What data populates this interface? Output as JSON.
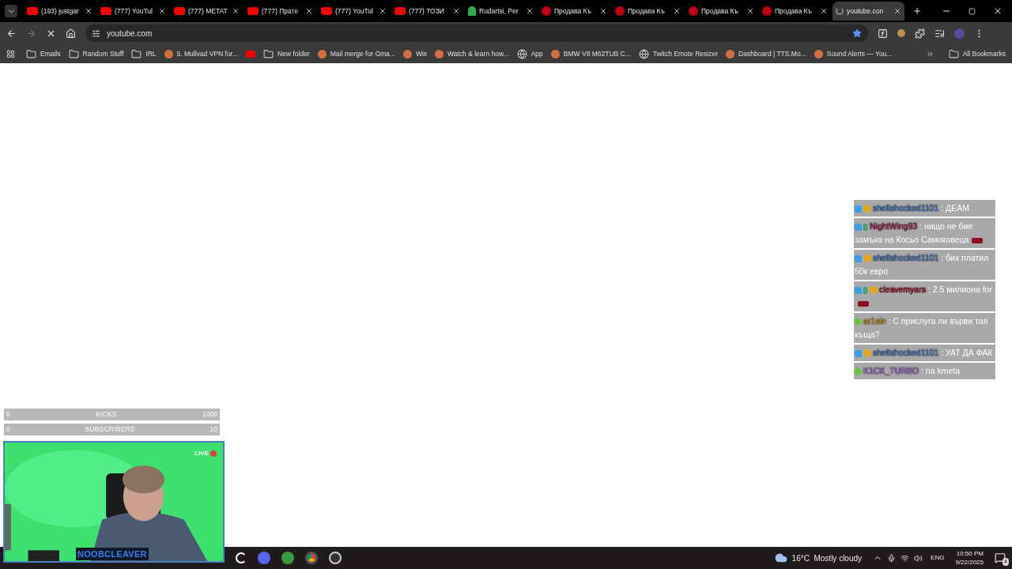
{
  "tabs": [
    {
      "title": "(193) justgar",
      "kind": "youtube",
      "selected": false
    },
    {
      "title": "(777) YouTul",
      "kind": "youtube",
      "selected": false
    },
    {
      "title": "(777) METAT",
      "kind": "youtube",
      "selected": false
    },
    {
      "title": "(777) Прате",
      "kind": "youtube",
      "selected": false
    },
    {
      "title": "(777) YouTul",
      "kind": "youtube",
      "selected": false
    },
    {
      "title": "(777) ТОЗИ",
      "kind": "youtube",
      "selected": false
    },
    {
      "title": "Rudartsi, Per",
      "kind": "maps",
      "selected": false
    },
    {
      "title": "Продава Къ",
      "kind": "red",
      "selected": false
    },
    {
      "title": "Продава Къ",
      "kind": "red",
      "selected": false
    },
    {
      "title": "Продава Къ",
      "kind": "red",
      "selected": false
    },
    {
      "title": "Продава Къ",
      "kind": "red",
      "selected": false
    },
    {
      "title": "youtube.con",
      "kind": "loading",
      "selected": true
    }
  ],
  "address": "youtube.com",
  "bookmarked": true,
  "bookmarks": [
    {
      "label": "Emails",
      "kind": "folder"
    },
    {
      "label": "Random Stuff",
      "kind": "folder"
    },
    {
      "label": "IRL",
      "kind": "folder"
    },
    {
      "label": "5. Mullvad VPN for...",
      "kind": "site"
    },
    {
      "kind": "youtube"
    },
    {
      "label": "New folder",
      "kind": "folder"
    },
    {
      "label": "Mail merge for Gma...",
      "kind": "site"
    },
    {
      "label": "Wix",
      "kind": "site"
    },
    {
      "label": "Watch & learn how...",
      "kind": "site"
    },
    {
      "label": "App",
      "kind": "globe"
    },
    {
      "label": "BMW V8 M62TUB C...",
      "kind": "site"
    },
    {
      "label": "Twitch Emote Resizer",
      "kind": "globe"
    },
    {
      "label": "Dashboard | TTS.Mo...",
      "kind": "site"
    },
    {
      "label": "Sound Alerts — You...",
      "kind": "site"
    }
  ],
  "all_bookmarks": "All Bookmarks",
  "chat": [
    {
      "user": "shellshocked1101",
      "color": "#4a7fd0",
      "message": ": ДЕАМ",
      "badges": [
        {
          "kind": "cube"
        },
        {
          "kind": "coin"
        }
      ],
      "emote": false
    },
    {
      "user": "NightWing93",
      "color": "#a8205a",
      "message": ": нищо не бие замъка на Косьо Самоковеца",
      "badges": [
        {
          "kind": "cube"
        },
        {
          "kind": "zero"
        }
      ],
      "emote": true
    },
    {
      "user": "shellshocked1101",
      "color": "#4a7fd0",
      "message": ": бих платил 50к евро",
      "badges": [
        {
          "kind": "cube"
        },
        {
          "kind": "coin"
        }
      ],
      "emote": false
    },
    {
      "user": "cleavemyars",
      "color": "#b0102a",
      "message": ": 2.5 милиона for",
      "badges": [
        {
          "kind": "cube"
        },
        {
          "kind": "zero"
        },
        {
          "kind": "coin"
        }
      ],
      "emote": true
    },
    {
      "user": "ar1sin",
      "color": "#d8a020",
      "message": ": С прислуга ли върви тая къща?",
      "badges": [
        {
          "kind": "gem"
        }
      ],
      "emote": false
    },
    {
      "user": "shellshocked1101",
      "color": "#4a7fd0",
      "message": ": УАТ ДА ФАК",
      "badges": [
        {
          "kind": "cube"
        },
        {
          "kind": "coin"
        }
      ],
      "emote": false
    },
    {
      "user": "K1CK_TURBO",
      "color": "#b070e0",
      "message": ": na kmeta",
      "badges": [
        {
          "kind": "gem"
        }
      ],
      "emote": false
    }
  ],
  "goals": [
    {
      "current": "6",
      "label": "KICKS",
      "target": "1000"
    },
    {
      "current": "0",
      "label": "SUBSCRIBERS",
      "target": "10"
    }
  ],
  "webcam": {
    "kind": "picture",
    "live": "LIVE",
    "name": "NOOBCLEAVER"
  },
  "taskbar": {
    "weather": "16°C  Mostly cloudy",
    "language": "ENG",
    "time": "10:50 PM",
    "date": "9/22/2025",
    "notifications": "4"
  }
}
